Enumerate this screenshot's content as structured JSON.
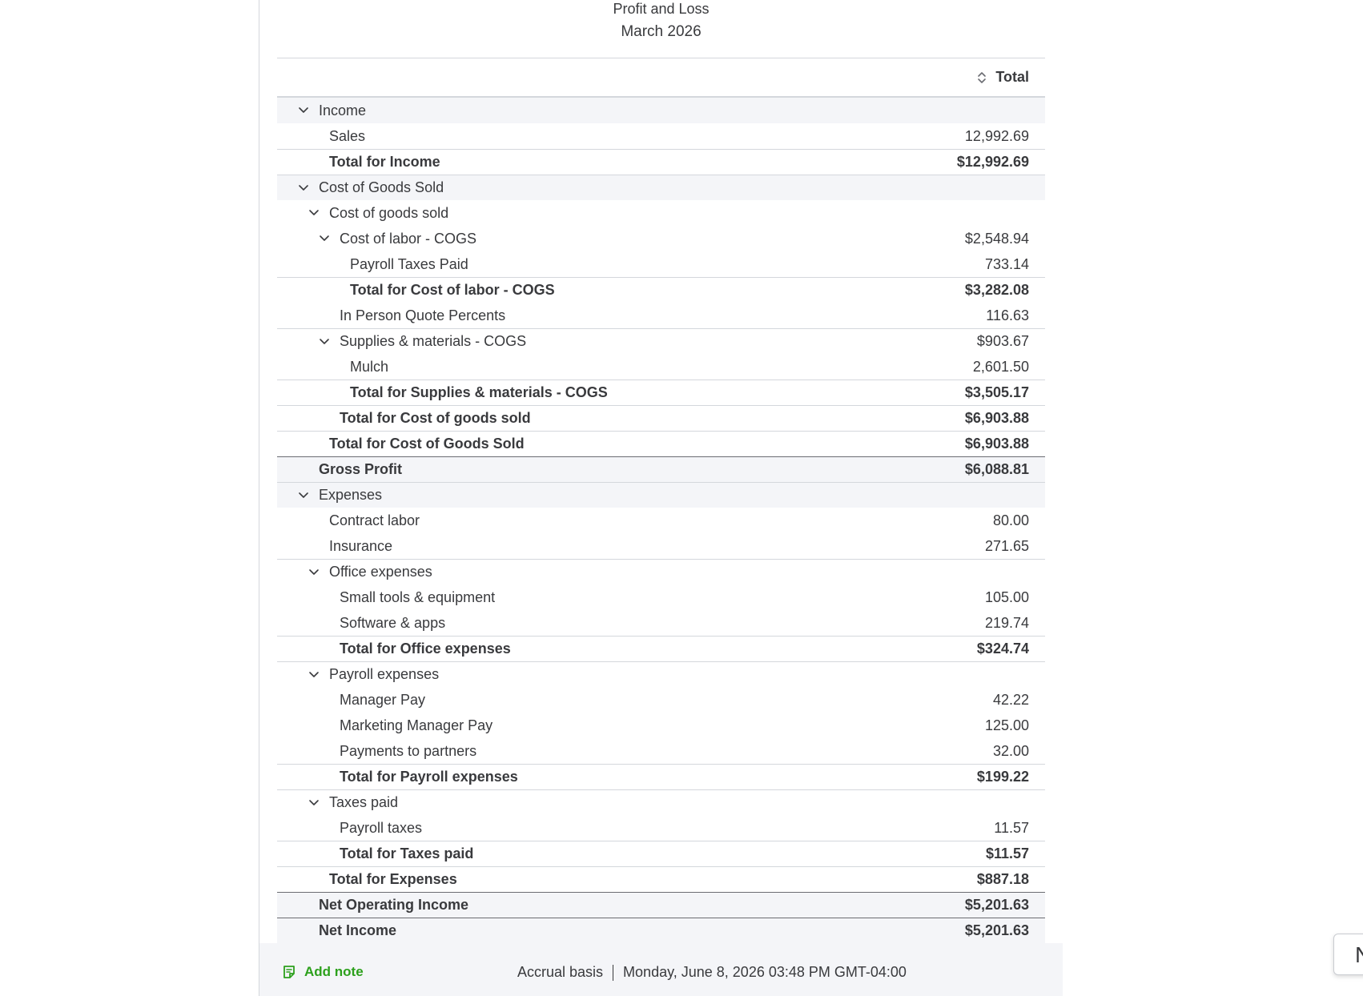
{
  "report": {
    "title": "Profit and Loss",
    "period": "March 2026",
    "column_header": "Total"
  },
  "rows": [
    {
      "label": "Income",
      "value": "",
      "kind": "section",
      "collapsible": true
    },
    {
      "label": "Sales",
      "value": "12,992.69",
      "kind": "item"
    },
    {
      "label": "Total for Income",
      "value": "$12,992.69",
      "kind": "total"
    },
    {
      "label": "Cost of Goods Sold",
      "value": "",
      "kind": "section",
      "collapsible": true
    },
    {
      "label": "Cost of goods sold",
      "value": "",
      "kind": "group",
      "collapsible": true
    },
    {
      "label": "Cost of labor - COGS",
      "value": "$2,548.94",
      "kind": "group",
      "collapsible": true
    },
    {
      "label": "Payroll Taxes Paid",
      "value": "733.14",
      "kind": "item"
    },
    {
      "label": "Total for Cost of labor - COGS",
      "value": "$3,282.08",
      "kind": "total"
    },
    {
      "label": "In Person Quote Percents",
      "value": "116.63",
      "kind": "item"
    },
    {
      "label": "Supplies & materials - COGS",
      "value": "$903.67",
      "kind": "group",
      "collapsible": true
    },
    {
      "label": "Mulch",
      "value": "2,601.50",
      "kind": "item"
    },
    {
      "label": "Total for Supplies & materials - COGS",
      "value": "$3,505.17",
      "kind": "total"
    },
    {
      "label": "Total for Cost of goods sold",
      "value": "$6,903.88",
      "kind": "total"
    },
    {
      "label": "Total for Cost of Goods Sold",
      "value": "$6,903.88",
      "kind": "total"
    },
    {
      "label": "Gross Profit",
      "value": "$6,088.81",
      "kind": "grand"
    },
    {
      "label": "Expenses",
      "value": "",
      "kind": "section",
      "collapsible": true
    },
    {
      "label": "Contract labor",
      "value": "80.00",
      "kind": "item"
    },
    {
      "label": "Insurance",
      "value": "271.65",
      "kind": "item"
    },
    {
      "label": "Office expenses",
      "value": "",
      "kind": "group",
      "collapsible": true
    },
    {
      "label": "Small tools & equipment",
      "value": "105.00",
      "kind": "item"
    },
    {
      "label": "Software & apps",
      "value": "219.74",
      "kind": "item"
    },
    {
      "label": "Total for Office expenses",
      "value": "$324.74",
      "kind": "total"
    },
    {
      "label": "Payroll expenses",
      "value": "",
      "kind": "group",
      "collapsible": true
    },
    {
      "label": "Manager Pay",
      "value": "42.22",
      "kind": "item"
    },
    {
      "label": "Marketing Manager Pay",
      "value": "125.00",
      "kind": "item"
    },
    {
      "label": "Payments to partners",
      "value": "32.00",
      "kind": "item"
    },
    {
      "label": "Total for Payroll expenses",
      "value": "$199.22",
      "kind": "total"
    },
    {
      "label": "Taxes paid",
      "value": "",
      "kind": "group",
      "collapsible": true
    },
    {
      "label": "Payroll taxes",
      "value": "11.57",
      "kind": "item"
    },
    {
      "label": "Total for Taxes paid",
      "value": "$11.57",
      "kind": "total"
    },
    {
      "label": "Total for Expenses",
      "value": "$887.18",
      "kind": "total"
    },
    {
      "label": "Net Operating Income",
      "value": "$5,201.63",
      "kind": "grand"
    },
    {
      "label": "Net Income",
      "value": "$5,201.63",
      "kind": "grand"
    }
  ],
  "footer": {
    "add_note_label": "Add note",
    "basis": "Accrual basis",
    "timestamp": "Monday, June 8, 2026 03:48 PM GMT-04:00"
  },
  "side_widget": {
    "text": "N"
  },
  "colors": {
    "accent_green": "#2ca01c",
    "text": "#393a3d",
    "section_bg": "#f4f5f8",
    "rule": "#d4d7dc"
  },
  "icons": {
    "sort": "sort-toggle-icon",
    "chevron": "chevron-down-icon",
    "note": "note-icon"
  }
}
